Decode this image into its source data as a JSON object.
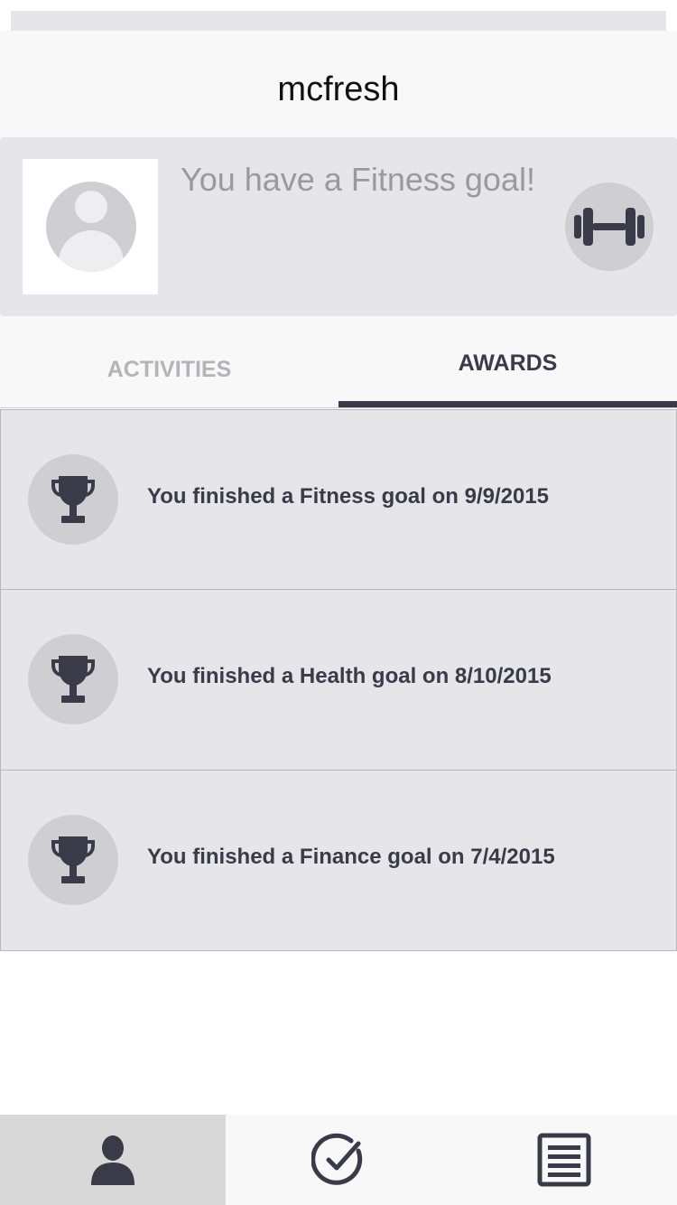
{
  "app": {
    "title": "mcfresh"
  },
  "profile": {
    "goal_message": "You have a Fitness goal!",
    "goal_icon": "dumbbell-icon",
    "avatar_icon": "avatar-placeholder-icon"
  },
  "tabs": [
    {
      "label": "ACTIVITIES",
      "selected": false
    },
    {
      "label": "AWARDS",
      "selected": true
    }
  ],
  "awards": [
    {
      "icon": "trophy-icon",
      "text": "You finished a Fitness goal on 9/9/2015"
    },
    {
      "icon": "trophy-icon",
      "text": "You finished a Health goal on 8/10/2015"
    },
    {
      "icon": "trophy-icon",
      "text": "You finished a Finance goal on 7/4/2015"
    }
  ],
  "tab_bar": [
    {
      "icon": "person-icon",
      "selected": true
    },
    {
      "icon": "checkmark-circle-icon",
      "selected": false
    },
    {
      "icon": "list-icon",
      "selected": false
    }
  ],
  "colors": {
    "accent": "#3a3a48",
    "card_background": "#e6e6ea",
    "icon_circle": "#cfced3",
    "muted_text": "#9a9a9e"
  }
}
